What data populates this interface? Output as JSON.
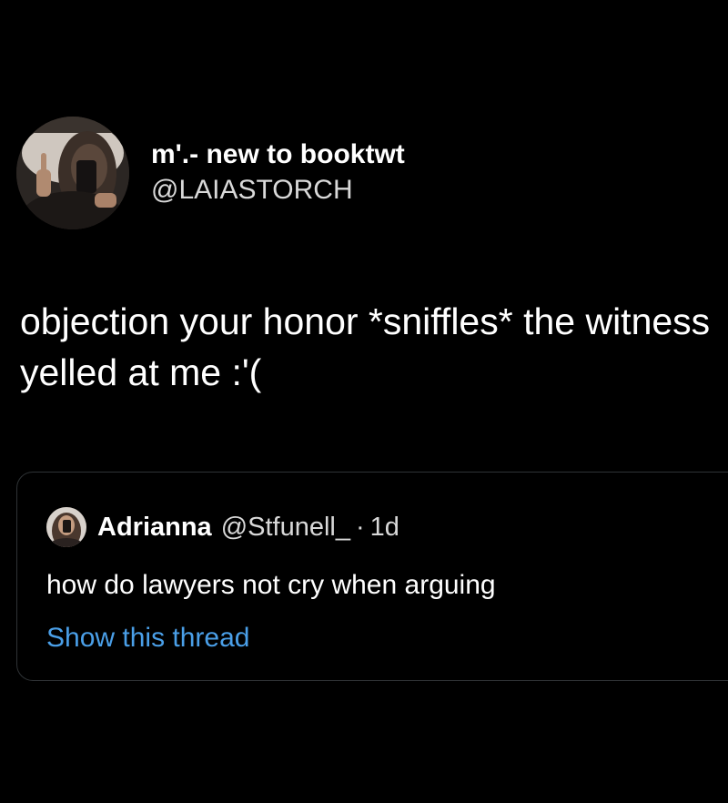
{
  "tweet": {
    "author": {
      "display_name": "m'.- new to booktwt",
      "handle": "@LAIASTORCH",
      "avatar_icon": "profile-photo"
    },
    "text": "objection your honor *sniffles* the witness yelled at me :'("
  },
  "quoted_tweet": {
    "author": {
      "display_name": "Adrianna",
      "handle": "@Stfunell_",
      "avatar_icon": "profile-photo"
    },
    "separator": "·",
    "time": "1d",
    "text": "how do lawyers not cry when arguing",
    "show_thread_label": "Show this thread"
  },
  "colors": {
    "background": "#000000",
    "primary_text": "#ffffff",
    "secondary_text": "#d9d9d9",
    "link": "#4a9fe8",
    "border": "#2f3336"
  }
}
